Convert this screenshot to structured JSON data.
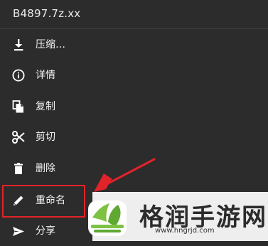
{
  "menu": {
    "title": "B4897.7z.xx",
    "items": [
      {
        "label": "压缩…",
        "icon": "download-icon"
      },
      {
        "label": "详情",
        "icon": "info-icon"
      },
      {
        "label": "复制",
        "icon": "copy-icon"
      },
      {
        "label": "剪切",
        "icon": "scissors-icon"
      },
      {
        "label": "删除",
        "icon": "trash-icon"
      },
      {
        "label": "重命名",
        "icon": "pencil-icon"
      },
      {
        "label": "分享",
        "icon": "share-icon"
      }
    ]
  },
  "annotation": {
    "highlight_color": "#e2232a",
    "highlighted_item": "重命名"
  },
  "watermark": {
    "title": "格润手游网",
    "url": "www.hngrjd.com",
    "accent_color": "#7dc242"
  },
  "colors": {
    "background": "#2c2c2c",
    "text": "#f2f2f2"
  }
}
